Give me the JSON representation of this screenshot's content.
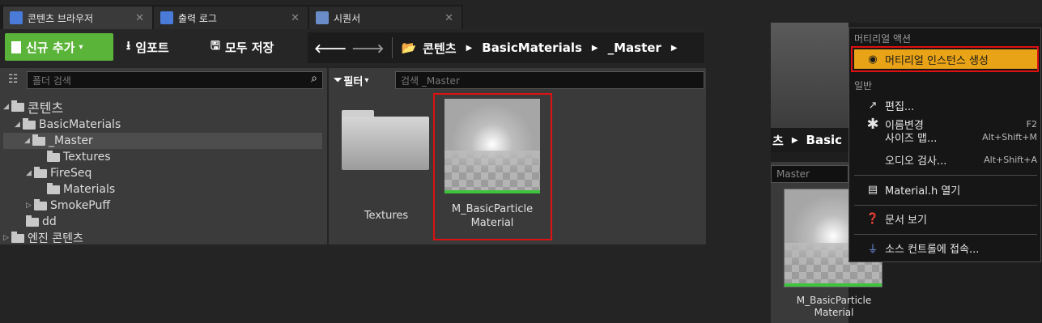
{
  "tabs": [
    {
      "label": "콘텐츠 브라우저",
      "icon": "content-browser-icon"
    },
    {
      "label": "출력 로그",
      "icon": "output-log-icon"
    },
    {
      "label": "시퀀서",
      "icon": "sequencer-icon"
    }
  ],
  "toolbar": {
    "new_label": "신규 추가",
    "import_label": "임포트",
    "save_all_label": "모두 저장"
  },
  "breadcrumb": [
    "콘텐츠",
    "BasicMaterials",
    "_Master"
  ],
  "left_panel": {
    "search_placeholder": "폴더 검색",
    "tree": [
      {
        "label": "콘텐츠"
      },
      {
        "label": "BasicMaterials"
      },
      {
        "label": "_Master"
      },
      {
        "label": "Textures"
      },
      {
        "label": "FireSeq"
      },
      {
        "label": "Materials"
      },
      {
        "label": "SmokePuff"
      },
      {
        "label": "dd"
      },
      {
        "label": "엔진 콘텐츠"
      }
    ]
  },
  "asset_panel": {
    "filter_label": "필터",
    "search_placeholder": "검색 _Master",
    "assets": [
      {
        "label": "Textures"
      },
      {
        "label": "M_BasicParticle Material"
      }
    ]
  },
  "right_view": {
    "breadcrumb_fragment": "Basic",
    "breadcrumb_prefix": "츠",
    "search_fragment": "Master",
    "asset_label": "M_BasicParticle Material"
  },
  "context_menu": {
    "section_material": "머티리얼 액션",
    "create_instance": "머티리얼 인스턴스 생성",
    "section_general": "일반",
    "edit": "편집...",
    "rename": "이름변경",
    "rename_shortcut": "F2",
    "size_map": "사이즈 맵...",
    "size_map_shortcut": "Alt+Shift+M",
    "audio_check": "오디오 검사...",
    "audio_check_shortcut": "Alt+Shift+A",
    "open_header": "Material.h 열기",
    "docs": "문서 보기",
    "source_control": "소스 컨트롤에 접속..."
  },
  "colors": {
    "accent_green": "#5bb43a",
    "highlight_orange": "#e8a317",
    "annotation_red": "#dd1111"
  }
}
